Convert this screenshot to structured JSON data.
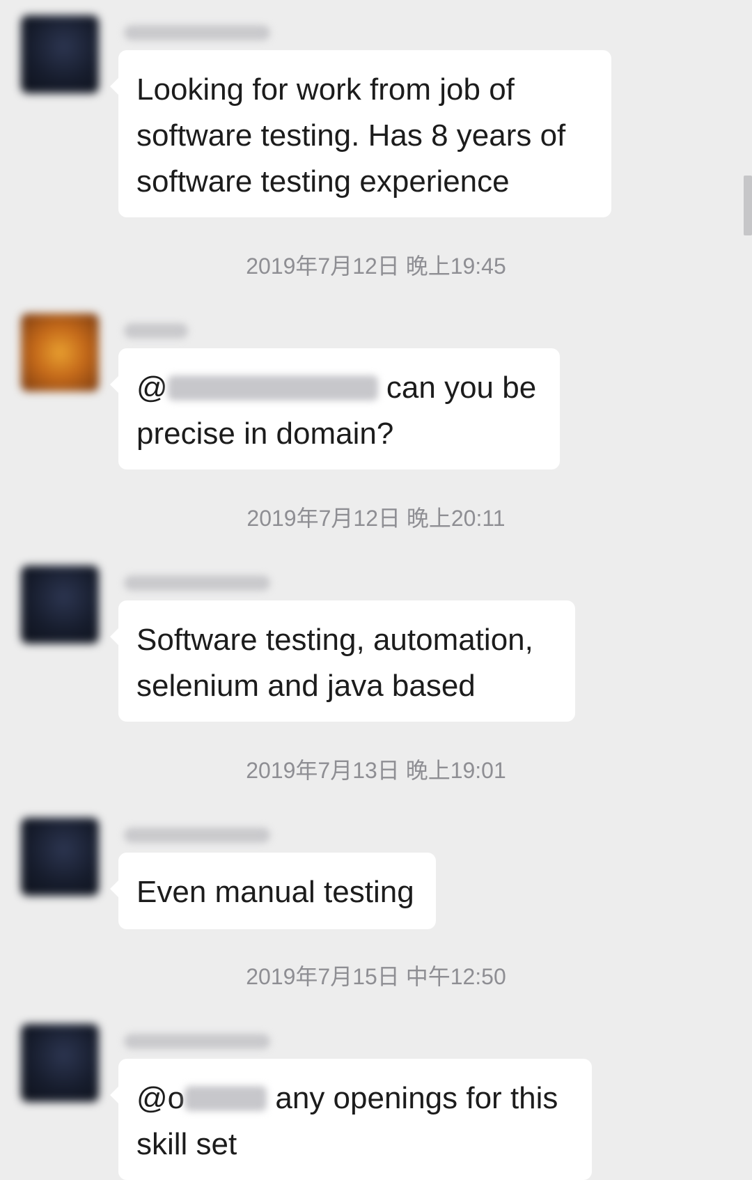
{
  "messages": [
    {
      "text": "Looking for work from job of software testing. Has 8 years of software testing experience"
    },
    {
      "timestamp": "2019年7月12日 晚上19:45",
      "prefix": "@",
      "text": "can you be precise in domain?"
    },
    {
      "timestamp": "2019年7月12日 晚上20:11",
      "text": "Software testing, automation, selenium and java based"
    },
    {
      "timestamp": "2019年7月13日 晚上19:01",
      "text": "Even manual testing"
    },
    {
      "timestamp": "2019年7月15日 中午12:50",
      "prefix": "@o",
      "text": "any openings for this skill set"
    }
  ]
}
